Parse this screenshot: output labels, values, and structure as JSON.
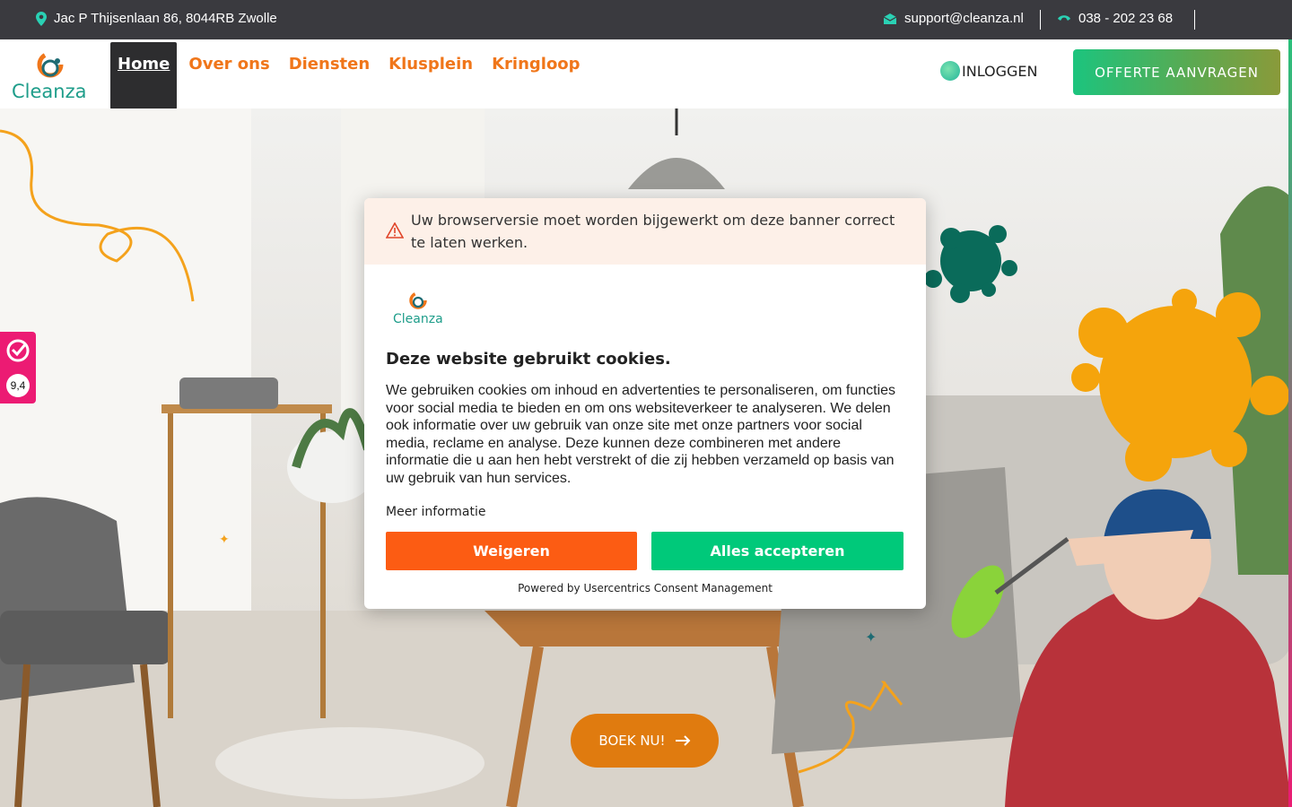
{
  "topbar": {
    "address": "Jac P Thijsenlaan 86, 8044RB Zwolle",
    "email": "support@cleanza.nl",
    "phone": "038 - 202 23 68"
  },
  "brand": {
    "name": "Cleanza"
  },
  "nav": {
    "items": [
      {
        "label": "Home"
      },
      {
        "label": "Over ons"
      },
      {
        "label": "Diensten"
      },
      {
        "label": "Klusplein"
      },
      {
        "label": "Kringloop"
      }
    ],
    "login": "INLOGGEN",
    "cta": "OFFERTE AANVRAGEN"
  },
  "rating": {
    "score": "9,4"
  },
  "hero": {
    "book_label": "BOEK NU!"
  },
  "cookie": {
    "warning": "Uw browserversie moet worden bijgewerkt om deze banner correct te laten werken.",
    "title": "Deze website gebruikt cookies.",
    "body": "We gebruiken cookies om inhoud en advertenties te personaliseren, om functies voor social media te bieden en om ons websiteverkeer te analyseren. We delen ook informatie over uw gebruik van onze site met onze partners voor social media, reclame en analyse. Deze kunnen deze combineren met andere informatie die u aan hen hebt verstrekt of die zij hebben verzameld op basis van uw gebruik van hun services.",
    "more_info": "Meer informatie",
    "deny": "Weigeren",
    "accept": "Alles accepteren",
    "powered": "Powered by Usercentrics Consent Management"
  },
  "colors": {
    "accent_orange": "#f0761a",
    "accent_green": "#00c97a",
    "deny_orange": "#fc5c13",
    "topbar": "#3a3a3f",
    "rating_pink": "#ec1b73"
  }
}
